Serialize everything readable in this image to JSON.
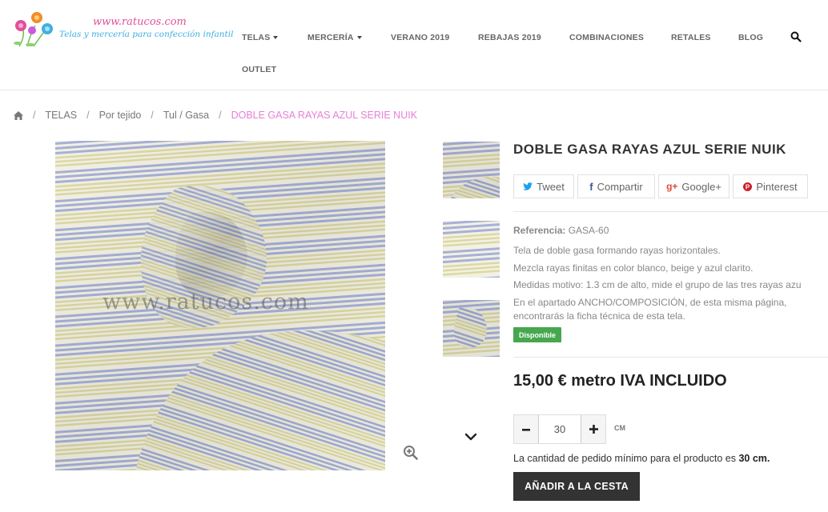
{
  "header": {
    "logo_url": "www.ratucos.com",
    "logo_tagline": "Telas y mercería para confección infantil",
    "nav": [
      {
        "label": "TELAS",
        "dropdown": true
      },
      {
        "label": "MERCERÍA",
        "dropdown": true
      },
      {
        "label": "VERANO 2019",
        "dropdown": false
      },
      {
        "label": "REBAJAS 2019",
        "dropdown": false
      },
      {
        "label": "COMBINACIONES",
        "dropdown": false
      },
      {
        "label": "RETALES",
        "dropdown": false
      },
      {
        "label": "BLOG",
        "dropdown": false
      },
      {
        "label": "OUTLET",
        "dropdown": false
      }
    ],
    "search_icon": "search-icon"
  },
  "breadcrumb": {
    "home_icon": "home-icon",
    "separator": "/",
    "items": [
      "TELAS",
      "Por tejido",
      "Tul / Gasa"
    ],
    "current": "DOBLE GASA RAYAS AZUL SERIE NUIK"
  },
  "gallery": {
    "watermark": "www.ratucos.com",
    "zoom_icon": "zoom-in-icon",
    "thumbs_down_icon": "chevron-down-icon"
  },
  "product": {
    "title": "DOBLE GASA RAYAS AZUL SERIE NUIK",
    "share": {
      "tweet": "Tweet",
      "compartir": "Compartir",
      "google": "Google+",
      "pinterest": "Pinterest"
    },
    "reference_label": "Referencia:",
    "reference_value": "GASA-60",
    "description": [
      "Tela de doble gasa formando rayas horizontales.",
      "Mezcla rayas finitas en color blanco, beige y azul clarito.",
      "Medidas motivo: 1.3 cm de alto, mide el grupo de las tres rayas azu",
      "En el apartado ANCHO/COMPOSICIÓN, de esta misma página,",
      "encontrarás la ficha técnica de esta tela."
    ],
    "availability": "Disponible",
    "price": "15,00 € metro IVA INCLUIDO",
    "quantity": "30",
    "quantity_unit": "CM",
    "min_order_prefix": "La cantidad de pedido mínimo para el producto es",
    "min_order_value": "30 cm.",
    "add_to_cart": "AÑADIR A LA CESTA",
    "colors": {
      "accent_pink": "#e77fd7",
      "available_green": "#46a74e",
      "twitter": "#1da1f2",
      "facebook": "#3b5998",
      "google": "#dd4b39",
      "pinterest": "#cb2027"
    }
  }
}
